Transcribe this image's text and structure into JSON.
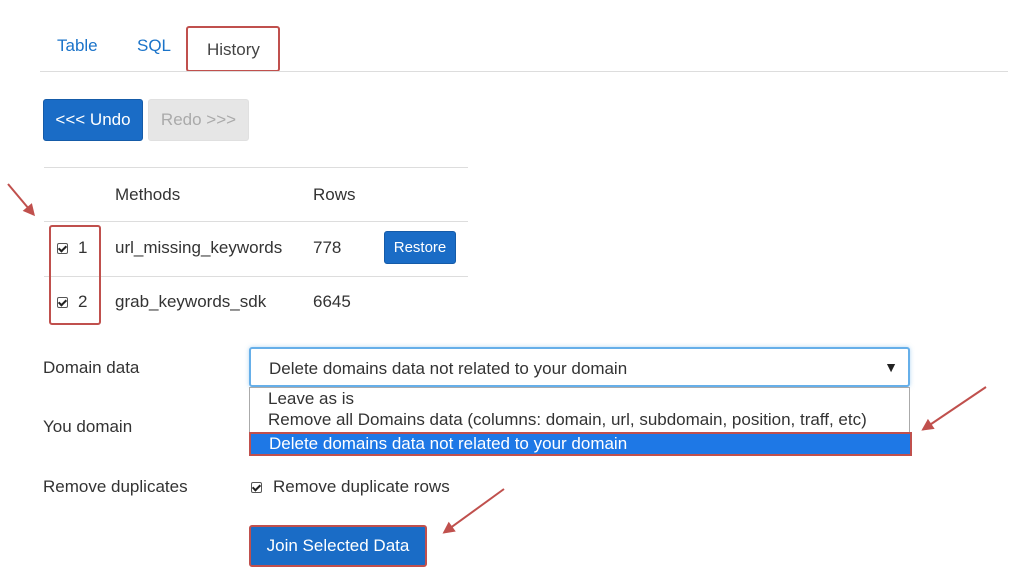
{
  "tabs": [
    {
      "label": "Table"
    },
    {
      "label": "SQL"
    },
    {
      "label": "History"
    }
  ],
  "toolbar": {
    "undo_label": "<<< Undo",
    "redo_label": "Redo >>>"
  },
  "table": {
    "headers": {
      "methods": "Methods",
      "rows": "Rows"
    },
    "rows": [
      {
        "num": "1",
        "method": "url_missing_keywords",
        "rows": "778",
        "checked": true,
        "action": "Restore"
      },
      {
        "num": "2",
        "method": "grab_keywords_sdk",
        "rows": "6645",
        "checked": true
      }
    ]
  },
  "form": {
    "domain_data_label": "Domain data",
    "domain_data_value": "Delete domains data not related to your domain",
    "options": [
      "Leave as is",
      "Remove all Domains data (columns: domain, url, subdomain, position, traff, etc)",
      "Delete domains data not related to your domain"
    ],
    "you_domain_label": "You domain",
    "remove_duplicates_label": "Remove duplicates",
    "remove_duplicates_checkbox_label": "Remove duplicate rows",
    "remove_duplicates_checked": true,
    "submit_label": "Join Selected Data"
  },
  "colors": {
    "accent": "#1a6cc6",
    "highlight": "#c0504d",
    "selected_option": "#1e78e6"
  }
}
